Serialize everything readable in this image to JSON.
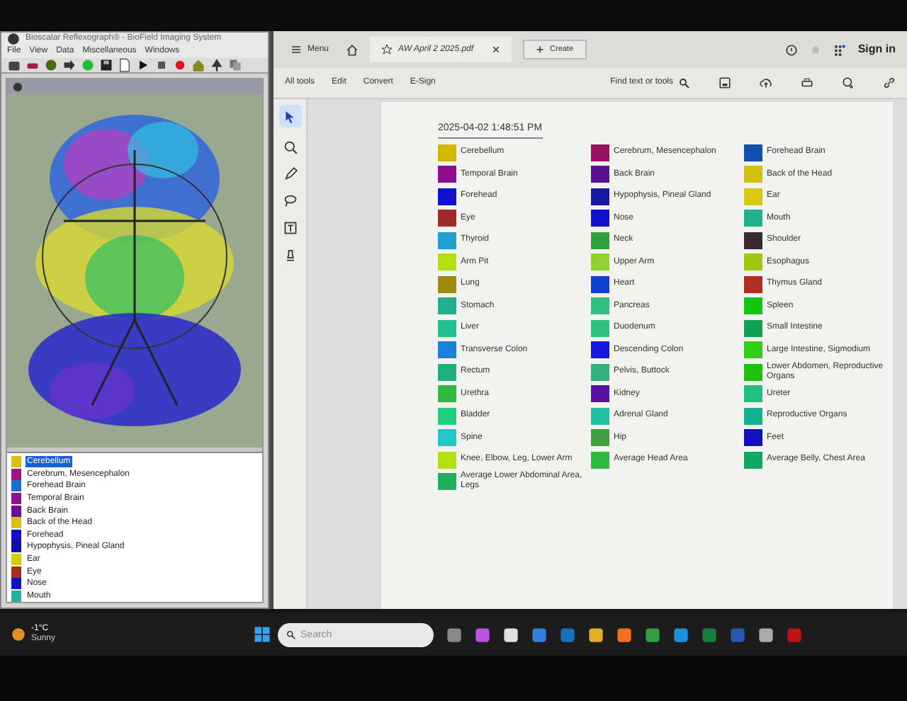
{
  "left_window": {
    "title": "Bioscalar Reflexograph® - BioField Imaging System",
    "menu": [
      "File",
      "View",
      "Data",
      "Miscellaneous",
      "Windows"
    ],
    "list": [
      {
        "label": "Cerebellum",
        "color": "#d8c010",
        "selected": true
      },
      {
        "label": "Cerebrum, Mesencephalon",
        "color": "#a01080",
        "selected": false
      },
      {
        "label": "Forehead Brain",
        "color": "#1a70d0",
        "selected": false
      },
      {
        "label": "Temporal Brain",
        "color": "#901090",
        "selected": false
      },
      {
        "label": "Back Brain",
        "color": "#6a1090",
        "selected": false
      },
      {
        "label": "Back of the Head",
        "color": "#d8c010",
        "selected": false
      },
      {
        "label": "Forehead",
        "color": "#1010c0",
        "selected": false
      },
      {
        "label": "Hypophysis, Pineal Gland",
        "color": "#1010a0",
        "selected": false
      },
      {
        "label": "Ear",
        "color": "#d8c810",
        "selected": false
      },
      {
        "label": "Eye",
        "color": "#a03020",
        "selected": false
      },
      {
        "label": "Nose",
        "color": "#1010c0",
        "selected": false
      },
      {
        "label": "Mouth",
        "color": "#20b0a0",
        "selected": false
      }
    ]
  },
  "pdf_window": {
    "menu_label": "Menu",
    "tab_title": "AW April 2 2025.pdf",
    "create_label": "Create",
    "sign_in": "Sign in",
    "toolbar": [
      "All tools",
      "Edit",
      "Convert",
      "E-Sign"
    ],
    "find_label": "Find text or tools",
    "document": {
      "timestamp": "2025-04-02 1:48:51 PM",
      "legend": [
        {
          "label": "Cerebellum",
          "color": "#d4b800"
        },
        {
          "label": "Cerebrum, Mesencephalon",
          "color": "#9a1060"
        },
        {
          "label": "Forehead Brain",
          "color": "#1050b0"
        },
        {
          "label": "Temporal Brain",
          "color": "#8e0f8e"
        },
        {
          "label": "Back Brain",
          "color": "#5a1090"
        },
        {
          "label": "Back of the Head",
          "color": "#d0c010"
        },
        {
          "label": "Forehead",
          "color": "#1010d0"
        },
        {
          "label": "Hypophysis, Pineal Gland",
          "color": "#1a1aa0"
        },
        {
          "label": "Ear",
          "color": "#d8c810"
        },
        {
          "label": "Eye",
          "color": "#a02828"
        },
        {
          "label": "Nose",
          "color": "#1010c8"
        },
        {
          "label": "Mouth",
          "color": "#20b090"
        },
        {
          "label": "Thyroid",
          "color": "#20a0d0"
        },
        {
          "label": "Neck",
          "color": "#30a040"
        },
        {
          "label": "Shoulder",
          "color": "#3a2a30"
        },
        {
          "label": "Arm Pit",
          "color": "#b0e010"
        },
        {
          "label": "Upper Arm",
          "color": "#90d030"
        },
        {
          "label": "Esophagus",
          "color": "#a0c810"
        },
        {
          "label": "Lung",
          "color": "#a08a10"
        },
        {
          "label": "Heart",
          "color": "#1040d0"
        },
        {
          "label": "Thymus Gland",
          "color": "#b03020"
        },
        {
          "label": "Stomach",
          "color": "#20b090"
        },
        {
          "label": "Pancreas",
          "color": "#30c080"
        },
        {
          "label": "Spleen",
          "color": "#10c810"
        },
        {
          "label": "Liver",
          "color": "#20c090"
        },
        {
          "label": "Duodenum",
          "color": "#30c080"
        },
        {
          "label": "Small Intestine",
          "color": "#10a050"
        },
        {
          "label": "Transverse Colon",
          "color": "#1a80d8"
        },
        {
          "label": "Descending Colon",
          "color": "#1818e0"
        },
        {
          "label": "Large Intestine, Sigmodium",
          "color": "#30d010"
        },
        {
          "label": "Rectum",
          "color": "#20b080"
        },
        {
          "label": "Pelvis, Buttock",
          "color": "#30b080"
        },
        {
          "label": "Lower Abdomen, Reproductive Organs",
          "color": "#20c010"
        },
        {
          "label": "Urethra",
          "color": "#30b840"
        },
        {
          "label": "Kidney",
          "color": "#5a10a0"
        },
        {
          "label": "Ureter",
          "color": "#20c080"
        },
        {
          "label": "Bladder",
          "color": "#20d080"
        },
        {
          "label": "Adrenal Gland",
          "color": "#20c0a0"
        },
        {
          "label": "Reproductive Organs",
          "color": "#10b090"
        },
        {
          "label": "Spine",
          "color": "#20c8c8"
        },
        {
          "label": "Hip",
          "color": "#40a040"
        },
        {
          "label": "Feet",
          "color": "#1010c0"
        },
        {
          "label": "Knee, Elbow, Leg, Lower Arm",
          "color": "#b0e010"
        },
        {
          "label": "Average Head Area",
          "color": "#30b840"
        },
        {
          "label": "Average Belly, Chest Area",
          "color": "#10a860"
        },
        {
          "label": "Average Lower Abdominal Area, Legs",
          "color": "#20b060"
        }
      ]
    }
  },
  "taskbar": {
    "temperature": "-1°C",
    "weather": "Sunny",
    "search_placeholder": "Search"
  }
}
